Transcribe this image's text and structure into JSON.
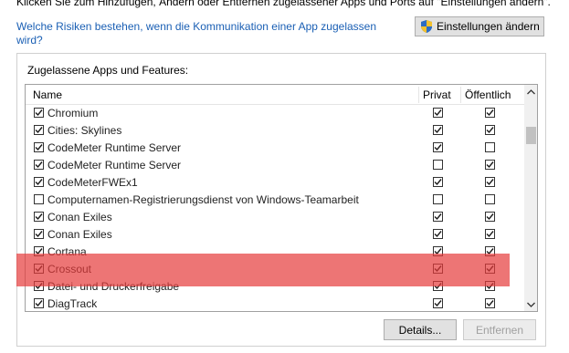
{
  "header": {
    "intro_text": "Klicken Sie zum Hinzufügen, Ändern oder Entfernen zugelassener Apps und Ports auf \"Einstellungen ändern\".",
    "risk_link": "Welche Risiken bestehen, wenn die Kommunikation einer App zugelassen wird?",
    "change_settings_label": "Einstellungen ändern"
  },
  "panel": {
    "title": "Zugelassene Apps und Features:",
    "columns": {
      "name": "Name",
      "private": "Privat",
      "public": "Öffentlich"
    },
    "rows": [
      {
        "name": "Chromium",
        "enabled": true,
        "private": true,
        "public": true
      },
      {
        "name": "Cities: Skylines",
        "enabled": true,
        "private": true,
        "public": true
      },
      {
        "name": "CodeMeter Runtime Server",
        "enabled": true,
        "private": true,
        "public": false
      },
      {
        "name": "CodeMeter Runtime Server",
        "enabled": true,
        "private": false,
        "public": true
      },
      {
        "name": "CodeMeterFWEx1",
        "enabled": true,
        "private": true,
        "public": true
      },
      {
        "name": "Computernamen-Registrierungsdienst von Windows-Teamarbeit",
        "enabled": false,
        "private": false,
        "public": false
      },
      {
        "name": "Conan Exiles",
        "enabled": true,
        "private": true,
        "public": true
      },
      {
        "name": "Conan Exiles",
        "enabled": true,
        "private": true,
        "public": true
      },
      {
        "name": "Cortana",
        "enabled": true,
        "private": true,
        "public": true
      },
      {
        "name": "Crossout",
        "enabled": true,
        "private": true,
        "public": true
      },
      {
        "name": "Datei- und Druckerfreigabe",
        "enabled": true,
        "private": true,
        "public": true
      },
      {
        "name": "DiagTrack",
        "enabled": true,
        "private": true,
        "public": true
      }
    ],
    "highlighted_row": "Crossout",
    "highlight_color": "#e63b3b",
    "details_label": "Details...",
    "remove_label": "Entfernen"
  },
  "colors": {
    "link": "#1a5fb4",
    "button_bg": "#e1e1e1"
  }
}
